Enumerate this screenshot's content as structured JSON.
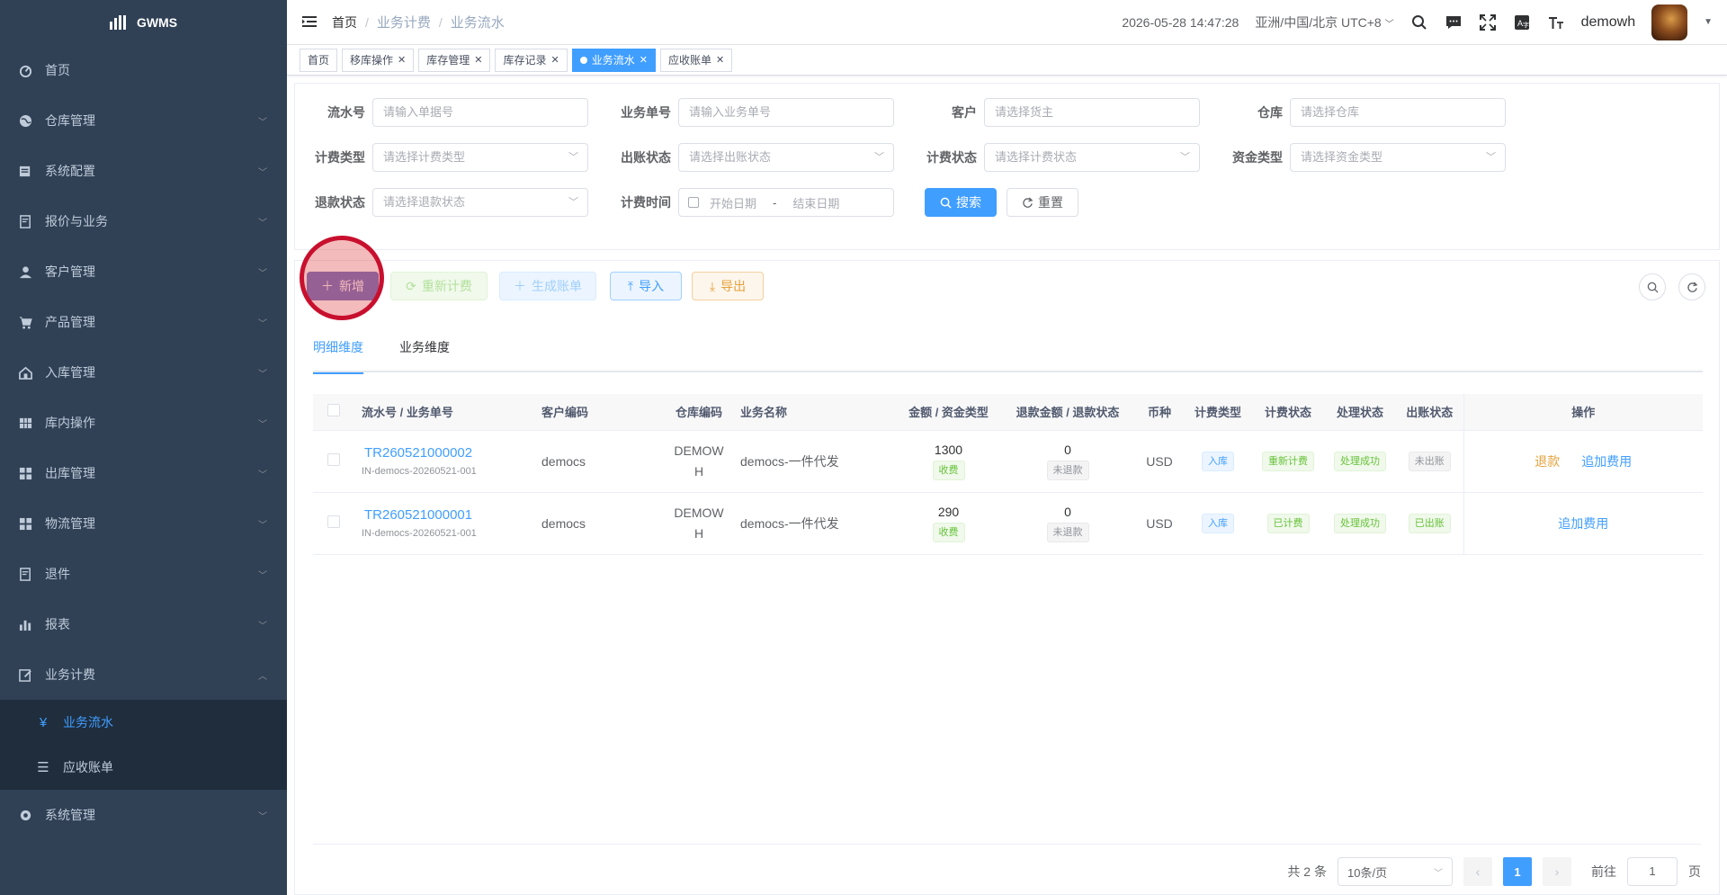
{
  "app": {
    "name": "GWMS"
  },
  "sidebar": {
    "items": [
      {
        "label": "首页",
        "icon": "dashboard-icon"
      },
      {
        "label": "仓库管理",
        "icon": "globe-icon"
      },
      {
        "label": "系统配置",
        "icon": "config-icon"
      },
      {
        "label": "报价与业务",
        "icon": "quote-icon"
      },
      {
        "label": "客户管理",
        "icon": "user-icon"
      },
      {
        "label": "产品管理",
        "icon": "cart-icon"
      },
      {
        "label": "入库管理",
        "icon": "home-icon"
      },
      {
        "label": "库内操作",
        "icon": "grid-icon"
      },
      {
        "label": "出库管理",
        "icon": "apps-icon"
      },
      {
        "label": "物流管理",
        "icon": "apps-icon"
      },
      {
        "label": "退件",
        "icon": "return-icon"
      },
      {
        "label": "报表",
        "icon": "chart-icon"
      },
      {
        "label": "业务计费",
        "icon": "edit-icon"
      },
      {
        "label": "系统管理",
        "icon": "gear-icon"
      }
    ],
    "billing_sub": [
      {
        "label": "业务流水",
        "icon": "yen-icon",
        "active": true
      },
      {
        "label": "应收账单",
        "icon": "list-icon",
        "active": false
      }
    ]
  },
  "navbar": {
    "breadcrumb": [
      "首页",
      "业务计费",
      "业务流水"
    ],
    "datetime": "2026-05-28 14:47:28",
    "timezone": "亚洲/中国/北京 UTC+8",
    "username": "demowh"
  },
  "tags": [
    {
      "label": "首页",
      "closable": false,
      "active": false
    },
    {
      "label": "移库操作",
      "closable": true,
      "active": false
    },
    {
      "label": "库存管理",
      "closable": true,
      "active": false
    },
    {
      "label": "库存记录",
      "closable": true,
      "active": false
    },
    {
      "label": "业务流水",
      "closable": true,
      "active": true
    },
    {
      "label": "应收账单",
      "closable": true,
      "active": false
    }
  ],
  "search": {
    "serial_label": "流水号",
    "serial_placeholder": "请输入单据号",
    "bizno_label": "业务单号",
    "bizno_placeholder": "请输入业务单号",
    "customer_label": "客户",
    "customer_placeholder": "请选择货主",
    "warehouse_label": "仓库",
    "warehouse_placeholder": "请选择仓库",
    "feetype_label": "计费类型",
    "feetype_placeholder": "请选择计费类型",
    "billstatus_label": "出账状态",
    "billstatus_placeholder": "请选择出账状态",
    "feestatus_label": "计费状态",
    "feestatus_placeholder": "请选择计费状态",
    "fundtype_label": "资金类型",
    "fundtype_placeholder": "请选择资金类型",
    "refund_label": "退款状态",
    "refund_placeholder": "请选择退款状态",
    "time_label": "计费时间",
    "start_placeholder": "开始日期",
    "end_placeholder": "结束日期",
    "range_sep": "-",
    "search_btn": "搜索",
    "reset_btn": "重置"
  },
  "toolbar": {
    "add": "新增",
    "recalc": "重新计费",
    "bill": "生成账单",
    "import": "导入",
    "export": "导出"
  },
  "tabs": [
    "明细维度",
    "业务维度"
  ],
  "table": {
    "headers": [
      "流水号 / 业务单号",
      "客户编码",
      "仓库编码",
      "业务名称",
      "金额 / 资金类型",
      "退款金额 / 退款状态",
      "币种",
      "计费类型",
      "计费状态",
      "处理状态",
      "出账状态",
      "操作"
    ],
    "rows": [
      {
        "serial": "TR260521000002",
        "bizno": "IN-democs-20260521-001",
        "customer": "democs",
        "warehouse": "DEMOWH",
        "bizname": "democs-一件代发",
        "amount": "1300",
        "fund_type": "收费",
        "refund_amount": "0",
        "refund_status": "未退款",
        "currency": "USD",
        "fee_type": "入库",
        "fee_status": "重新计费",
        "process_status": "处理成功",
        "bill_status": "未出账",
        "ops": [
          "退款",
          "追加费用"
        ]
      },
      {
        "serial": "TR260521000001",
        "bizno": "IN-democs-20260521-001",
        "customer": "democs",
        "warehouse": "DEMOWH",
        "bizname": "democs-一件代发",
        "amount": "290",
        "fund_type": "收费",
        "refund_amount": "0",
        "refund_status": "未退款",
        "currency": "USD",
        "fee_type": "入库",
        "fee_status": "已计费",
        "process_status": "处理成功",
        "bill_status": "已出账",
        "ops": [
          "追加费用"
        ]
      }
    ]
  },
  "pagination": {
    "total": "共 2 条",
    "page_size": "10条/页",
    "current": "1",
    "goto_label": "前往",
    "goto_value": "1",
    "page_unit": "页"
  }
}
